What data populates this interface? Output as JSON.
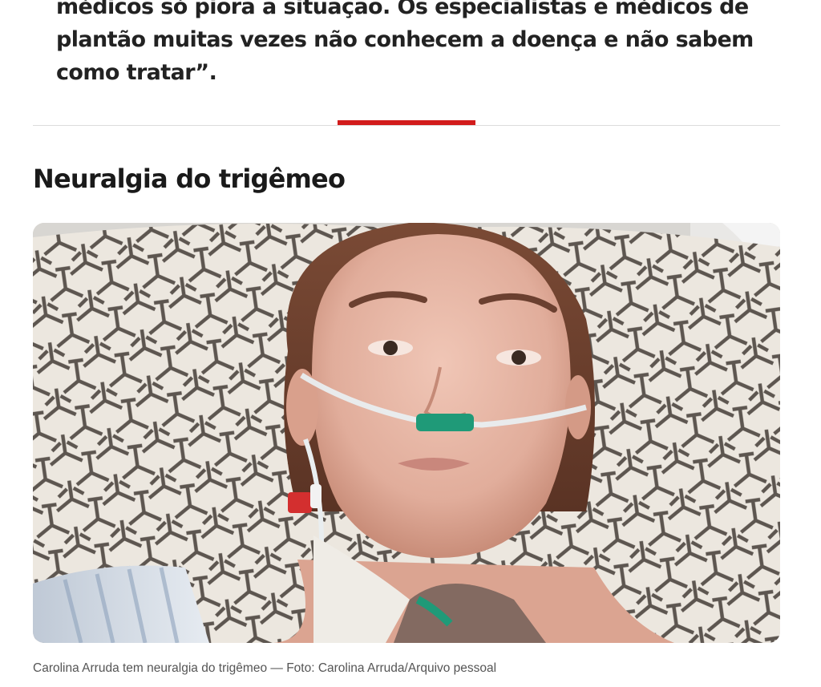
{
  "article": {
    "quote_lines": [
      "médicos só piora a situação. Os especialistas e médicos de",
      "plantão muitas vezes não conhecem a doença e não sabem",
      "como tratar”."
    ],
    "section_title": "Neuralgia do trigêmeo",
    "photo": {
      "alt": "Carolina Arruda tem neuralgia do trigêmeo",
      "caption": "Carolina Arruda tem neuralgia do trigêmeo — Foto: Carolina Arruda/Arquivo pessoal"
    }
  },
  "colors": {
    "accent": "#d21b1b",
    "divider": "#dcdcdc",
    "caption": "#555555",
    "heading": "#1a1a1a"
  }
}
